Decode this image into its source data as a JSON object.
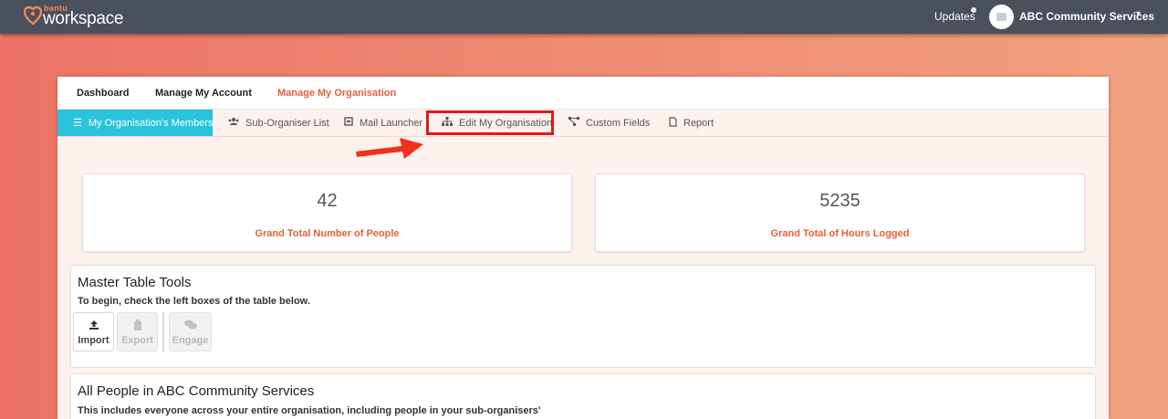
{
  "topbar": {
    "logo_small": "bantu",
    "logo_big": "workspace",
    "updates_label": "Updates",
    "org_name": "ABC Community Services",
    "caret": "▾"
  },
  "mainnav": {
    "items": [
      {
        "label": "Dashboard"
      },
      {
        "label": "Manage My Account"
      },
      {
        "label": "Manage My Organisation"
      }
    ]
  },
  "subnav": {
    "tabs": [
      {
        "label": "My Organisation's Members",
        "icon": "list-icon"
      },
      {
        "label": "Sub-Organiser List",
        "icon": "users-icon"
      },
      {
        "label": "Mail Launcher",
        "icon": "mail-icon"
      },
      {
        "label": "Edit My Organisation",
        "icon": "sitemap-icon"
      },
      {
        "label": "Custom Fields",
        "icon": "network-icon"
      },
      {
        "label": "Report",
        "icon": "file-icon"
      }
    ]
  },
  "stats": [
    {
      "value": "42",
      "label": "Grand Total Number of People"
    },
    {
      "value": "5235",
      "label": "Grand Total of Hours Logged"
    }
  ],
  "master_tools": {
    "title": "Master Table Tools",
    "subtitle": "To begin, check the left boxes of the table below.",
    "buttons": [
      {
        "label": "Import",
        "icon": "upload-icon"
      },
      {
        "label": "Export",
        "icon": "clipboard-icon"
      },
      {
        "label": "Engage",
        "icon": "comments-icon"
      }
    ]
  },
  "people": {
    "title": "All People in ABC Community Services",
    "subtitle": "This includes everyone across your entire organisation, including people in your sub-organisers'"
  },
  "colors": {
    "accent": "#e5603a",
    "active_tab": "#2bc3dc",
    "topbar": "#4a505c",
    "highlight": "#e1181b"
  }
}
